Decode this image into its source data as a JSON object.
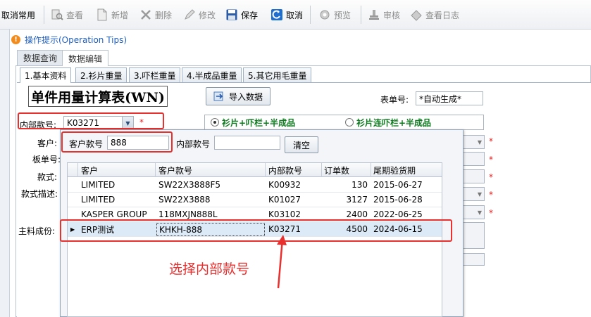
{
  "toolbar": {
    "items": [
      {
        "label": "取消常用",
        "icon": "star-remove-icon",
        "enabled": true
      },
      {
        "label": "查看",
        "icon": "view-icon",
        "enabled": false
      },
      {
        "label": "新增",
        "icon": "new-icon",
        "enabled": false
      },
      {
        "label": "删除",
        "icon": "delete-icon",
        "enabled": false
      },
      {
        "label": "修改",
        "icon": "edit-icon",
        "enabled": false
      },
      {
        "label": "保存",
        "icon": "save-icon",
        "enabled": true
      },
      {
        "label": "取消",
        "icon": "cancel-icon",
        "enabled": true
      },
      {
        "label": "预览",
        "icon": "preview-icon",
        "enabled": false
      },
      {
        "label": "审核",
        "icon": "audit-icon",
        "enabled": false
      },
      {
        "label": "查看日志",
        "icon": "log-icon",
        "enabled": false
      }
    ]
  },
  "tips": {
    "text": "操作提示(Operation Tips)"
  },
  "outer_tabs": [
    "数据查询",
    "数据编辑"
  ],
  "inner_tabs": [
    "1.基本资料",
    "2.衫片重量",
    "3.吓栏重量",
    "4.半成品重量",
    "5.其它用毛重量"
  ],
  "form": {
    "title": "单件用量计算表(WN)",
    "import_button": "导入数据",
    "order_no_label": "表单号:",
    "order_no_value": "*自动生成*",
    "internal_no_label": "内部款号:",
    "internal_no_value": "K03271",
    "required_mark": "*",
    "radio1": "衫片+吓栏+半成品",
    "radio2": "衫片连吓栏+半成品",
    "labels": [
      "客户:",
      "板单号:",
      "款式:",
      "款式描述:",
      "主料成份:"
    ]
  },
  "popup": {
    "customer_no_label": "客户款号",
    "customer_no_value": "888",
    "internal_no_label": "内部款号",
    "internal_no_value": "",
    "clear_button": "清空",
    "columns": [
      "客户",
      "客户款号",
      "内部款号",
      "订单数",
      "尾期验货期"
    ],
    "rows": [
      [
        "LIMITED",
        "SW22X3888F5",
        "K00932",
        "130",
        "2015-06-27"
      ],
      [
        "LIMITED",
        "SW22X3888",
        "K01027",
        "3127",
        "2015-06-28"
      ],
      [
        "KASPER GROUP",
        "118MXJN888L",
        "K03102",
        "2400",
        "2022-06-25"
      ],
      [
        "ERP测试",
        "KHKH-888",
        "K03271",
        "4500",
        "2024-06-15"
      ]
    ]
  },
  "annotation": "选择内部款号",
  "colors": {
    "highlight": "#e8302f",
    "link_blue": "#1f5fbf",
    "green_option": "#0f7a20"
  }
}
